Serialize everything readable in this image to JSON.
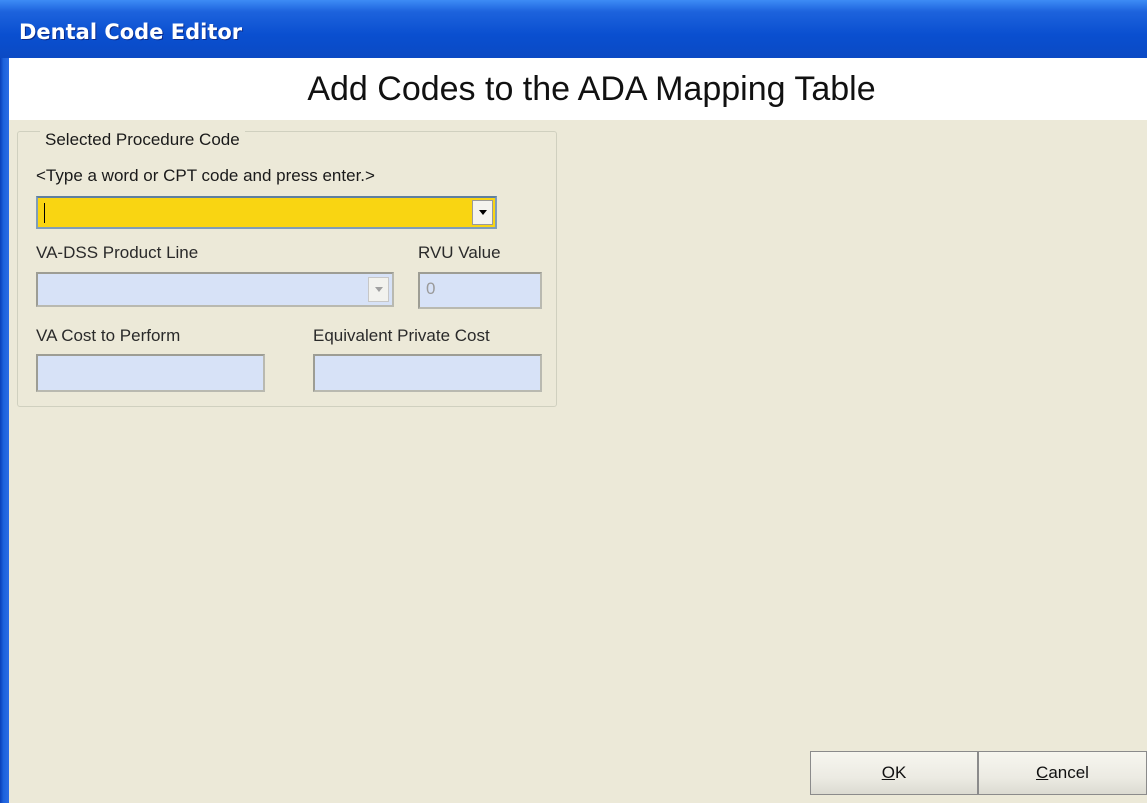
{
  "window": {
    "title": "Dental Code Editor"
  },
  "header": {
    "title": "Add Codes to the ADA Mapping Table"
  },
  "procedure_group": {
    "legend": "Selected Procedure Code",
    "hint": "<Type a word or CPT code and press enter.>",
    "procedure_combo": {
      "value": ""
    }
  },
  "fields": {
    "product_line_label": "VA-DSS Product Line",
    "product_line_value": "",
    "rvu_label": "RVU Value",
    "rvu_value": "0",
    "va_cost_label": "VA Cost to Perform",
    "va_cost_value": "",
    "private_cost_label": "Equivalent Private Cost",
    "private_cost_value": ""
  },
  "buttons": {
    "ok_accel": "O",
    "ok_rest": "K",
    "cancel_accel": "C",
    "cancel_rest": "ancel"
  },
  "colors": {
    "title_bar": "#0b4ac4",
    "window_bg": "#ece9d8",
    "highlight_field": "#f9d512",
    "disabled_field": "#d7e2f7"
  }
}
